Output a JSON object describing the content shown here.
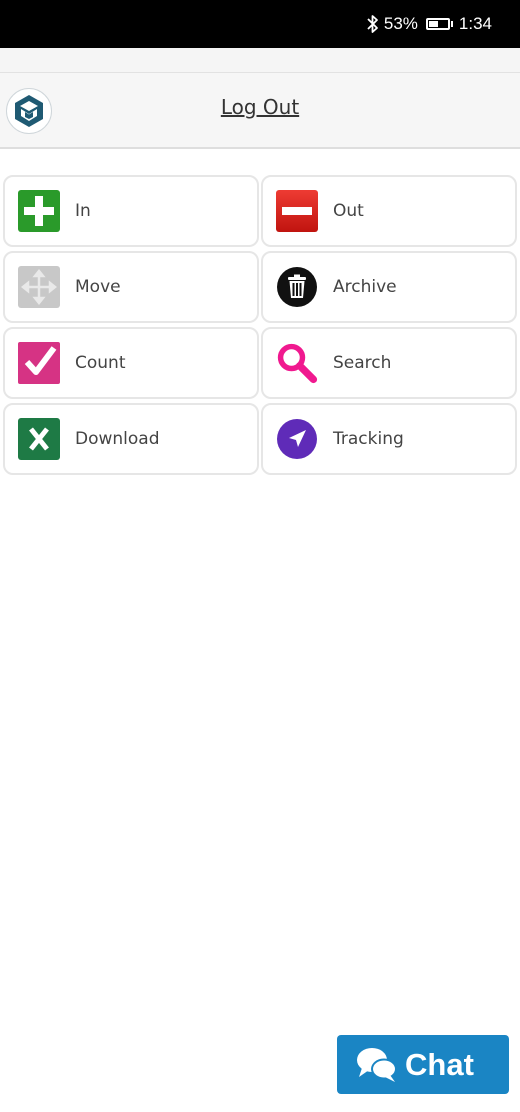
{
  "status_bar": {
    "bluetooth_icon": "bluetooth-icon",
    "battery_percent": "53%",
    "battery_level": 0.53,
    "battery_icon": "battery-icon",
    "time": "1:34"
  },
  "header": {
    "logo_icon": "app-logo",
    "logout_label": "Log Out"
  },
  "menu": {
    "items": [
      {
        "label": "In",
        "icon": "plus-icon",
        "color": "#2a9a2a"
      },
      {
        "label": "Out",
        "icon": "minus-icon",
        "color": "#d9201c"
      },
      {
        "label": "Move",
        "icon": "move-arrows-icon",
        "color": "#c8c8c8"
      },
      {
        "label": "Archive",
        "icon": "trash-icon",
        "color": "#111111"
      },
      {
        "label": "Count",
        "icon": "checkmark-icon",
        "color": "#d63384"
      },
      {
        "label": "Search",
        "icon": "magnifier-icon",
        "color": "#f0198f"
      },
      {
        "label": "Download",
        "icon": "excel-icon",
        "color": "#1e7a45"
      },
      {
        "label": "Tracking",
        "icon": "navigation-arrow-icon",
        "color": "#5f2bb8"
      }
    ]
  },
  "chat": {
    "label": "Chat",
    "icon": "chat-bubbles-icon",
    "color": "#1a85c4"
  }
}
